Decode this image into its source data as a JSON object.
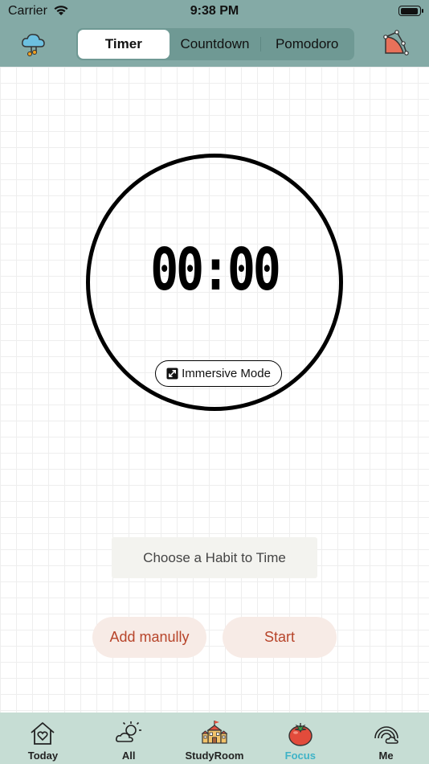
{
  "status_bar": {
    "carrier": "Carrier",
    "time": "9:38 PM"
  },
  "segments": [
    {
      "label": "Timer",
      "active": true
    },
    {
      "label": "Countdown",
      "active": false
    },
    {
      "label": "Pomodoro",
      "active": false
    }
  ],
  "nav": {
    "left_icon": "cloud-music-icon",
    "right_icon": "pie-chart-edit-icon"
  },
  "timer": {
    "display": "00:00",
    "immersive_label": "Immersive Mode"
  },
  "habit": {
    "placeholder": "Choose a Habit to Time"
  },
  "actions": {
    "add_label": "Add manully",
    "start_label": "Start"
  },
  "tabs": [
    {
      "label": "Today",
      "icon": "home-heart-icon"
    },
    {
      "label": "All",
      "icon": "sun-cloud-icon"
    },
    {
      "label": "StudyRoom",
      "icon": "school-icon"
    },
    {
      "label": "Focus",
      "icon": "tomato-icon",
      "active": true
    },
    {
      "label": "Me",
      "icon": "rainbow-cloud-icon"
    }
  ],
  "colors": {
    "header": "#84aaa6",
    "tab_bar": "#c6ddd4",
    "accent_text": "#b7442a",
    "active_tab": "#3fb3c7"
  }
}
